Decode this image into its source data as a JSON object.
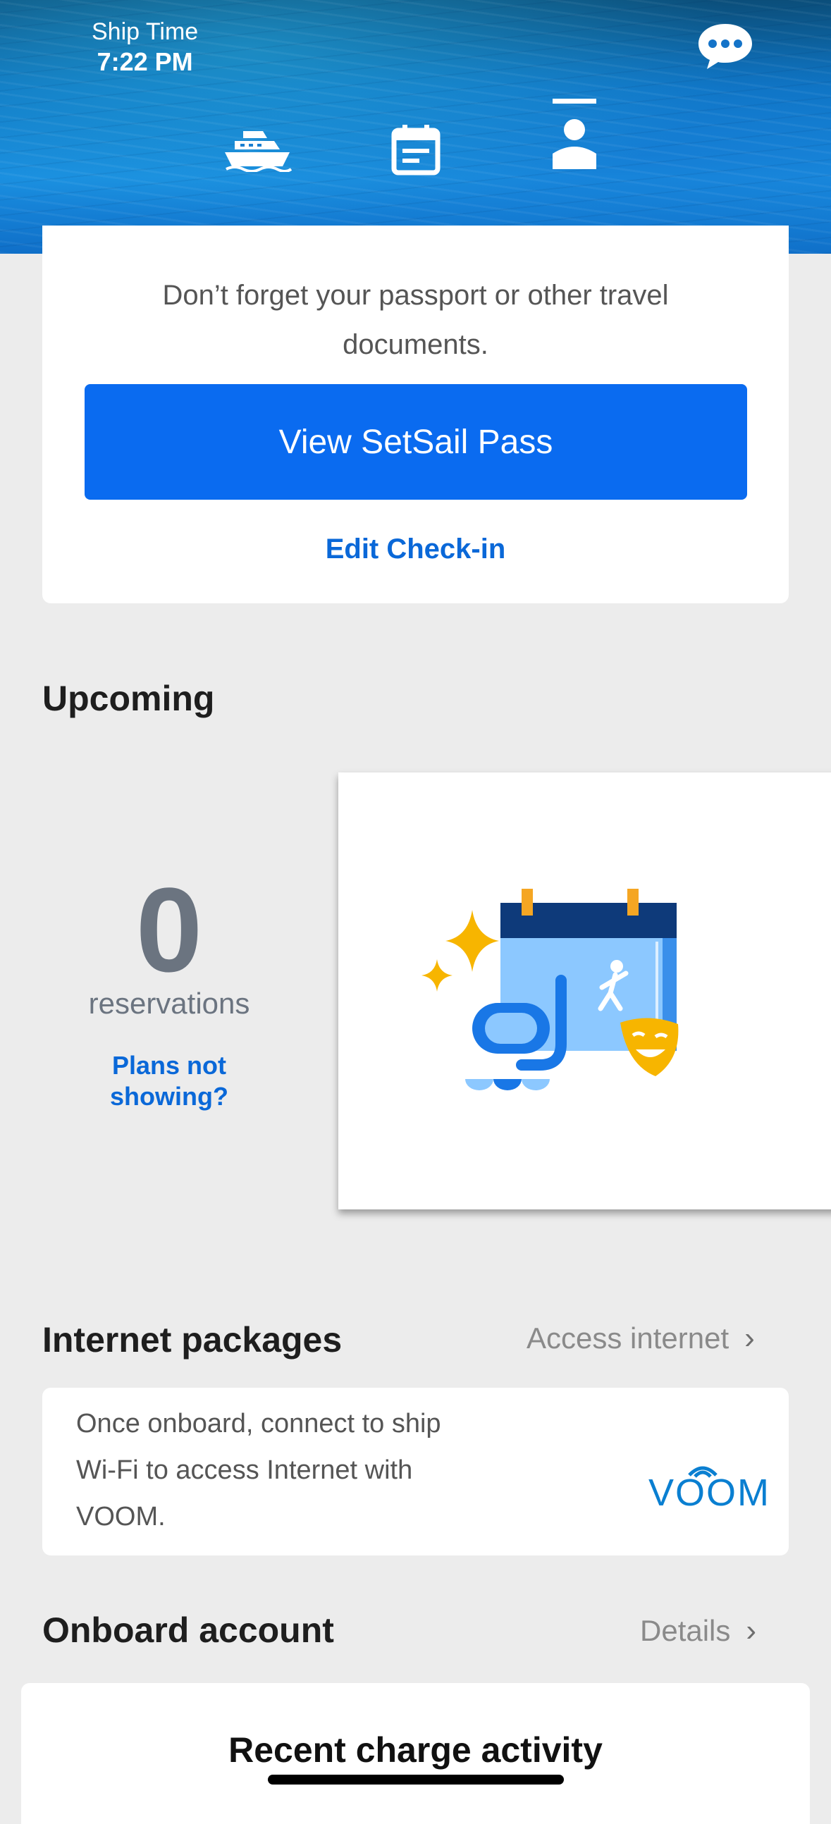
{
  "header": {
    "ship_time_label": "Ship Time",
    "ship_time_value": "7:22 PM",
    "nav": [
      "ship-icon",
      "calendar-icon",
      "person-icon"
    ],
    "chat_icon": "chat-bubble-icon"
  },
  "checkin": {
    "reminder": "Don’t forget your passport or other travel documents.",
    "primary_button": "View SetSail Pass",
    "edit_link": "Edit Check-in"
  },
  "upcoming": {
    "title": "Upcoming",
    "count": "0",
    "count_label": "reservations",
    "help_link_line1": "Plans not",
    "help_link_line2": "showing?"
  },
  "internet": {
    "title": "Internet packages",
    "link": "Access internet",
    "description_line1": "Once onboard, connect to ship",
    "description_line2": "Wi-Fi to access Internet with",
    "description_line3": "VOOM.",
    "brand": "VOOM"
  },
  "onboard_account": {
    "title": "Onboard account",
    "link": "Details",
    "card_title": "Recent charge activity"
  },
  "colors": {
    "primary": "#0a6bf0",
    "link": "#0a68d8",
    "count_gray": "#6b7480"
  }
}
